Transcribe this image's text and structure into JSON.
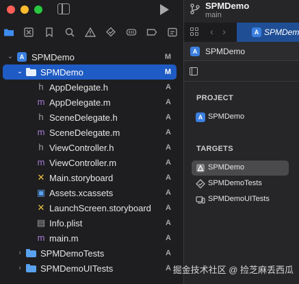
{
  "window": {
    "traffic_lights": [
      "#ff5f57",
      "#febc2e",
      "#28c840"
    ]
  },
  "navigator_icons": [
    "folder-icon",
    "source-control-icon",
    "bookmark-icon",
    "find-icon",
    "issue-icon",
    "test-icon",
    "debug-icon",
    "breakpoint-icon",
    "report-icon"
  ],
  "tree": {
    "items": [
      {
        "label": "SPMDemo",
        "status": "M",
        "icon": "project-icon"
      },
      {
        "label": "SPMDemo",
        "status": "M",
        "icon": "folder-icon"
      },
      {
        "label": "AppDelegate.h",
        "status": "A",
        "glyph": "h"
      },
      {
        "label": "AppDelegate.m",
        "status": "A",
        "glyph": "m"
      },
      {
        "label": "SceneDelegate.h",
        "status": "A",
        "glyph": "h"
      },
      {
        "label": "SceneDelegate.m",
        "status": "A",
        "glyph": "m"
      },
      {
        "label": "ViewController.h",
        "status": "A",
        "glyph": "h"
      },
      {
        "label": "ViewController.m",
        "status": "A",
        "glyph": "m"
      },
      {
        "label": "Main.storyboard",
        "status": "A",
        "glyph": "✕"
      },
      {
        "label": "Assets.xcassets",
        "status": "A",
        "glyph": "▣"
      },
      {
        "label": "LaunchScreen.storyboard",
        "status": "A",
        "glyph": "✕"
      },
      {
        "label": "Info.plist",
        "status": "A",
        "glyph": "▤"
      },
      {
        "label": "main.m",
        "status": "A",
        "glyph": "m"
      },
      {
        "label": "SPMDemoTests",
        "status": "A",
        "icon": "folder-icon"
      },
      {
        "label": "SPMDemoUITests",
        "status": "A",
        "icon": "folder-icon"
      }
    ]
  },
  "toolbar": {
    "project_name": "SPMDemo",
    "branch": "main"
  },
  "editor": {
    "tab_label": "SPMDemo",
    "jump_bar": "SPMDemo"
  },
  "project_panel": {
    "project_heading": "PROJECT",
    "project_item": "SPMDemo",
    "targets_heading": "TARGETS",
    "targets": [
      "SPMDemo",
      "SPMDemoTests",
      "SPMDemoUITests"
    ]
  },
  "watermark": "掘金技术社区 @ 捡芝麻丢西瓜"
}
